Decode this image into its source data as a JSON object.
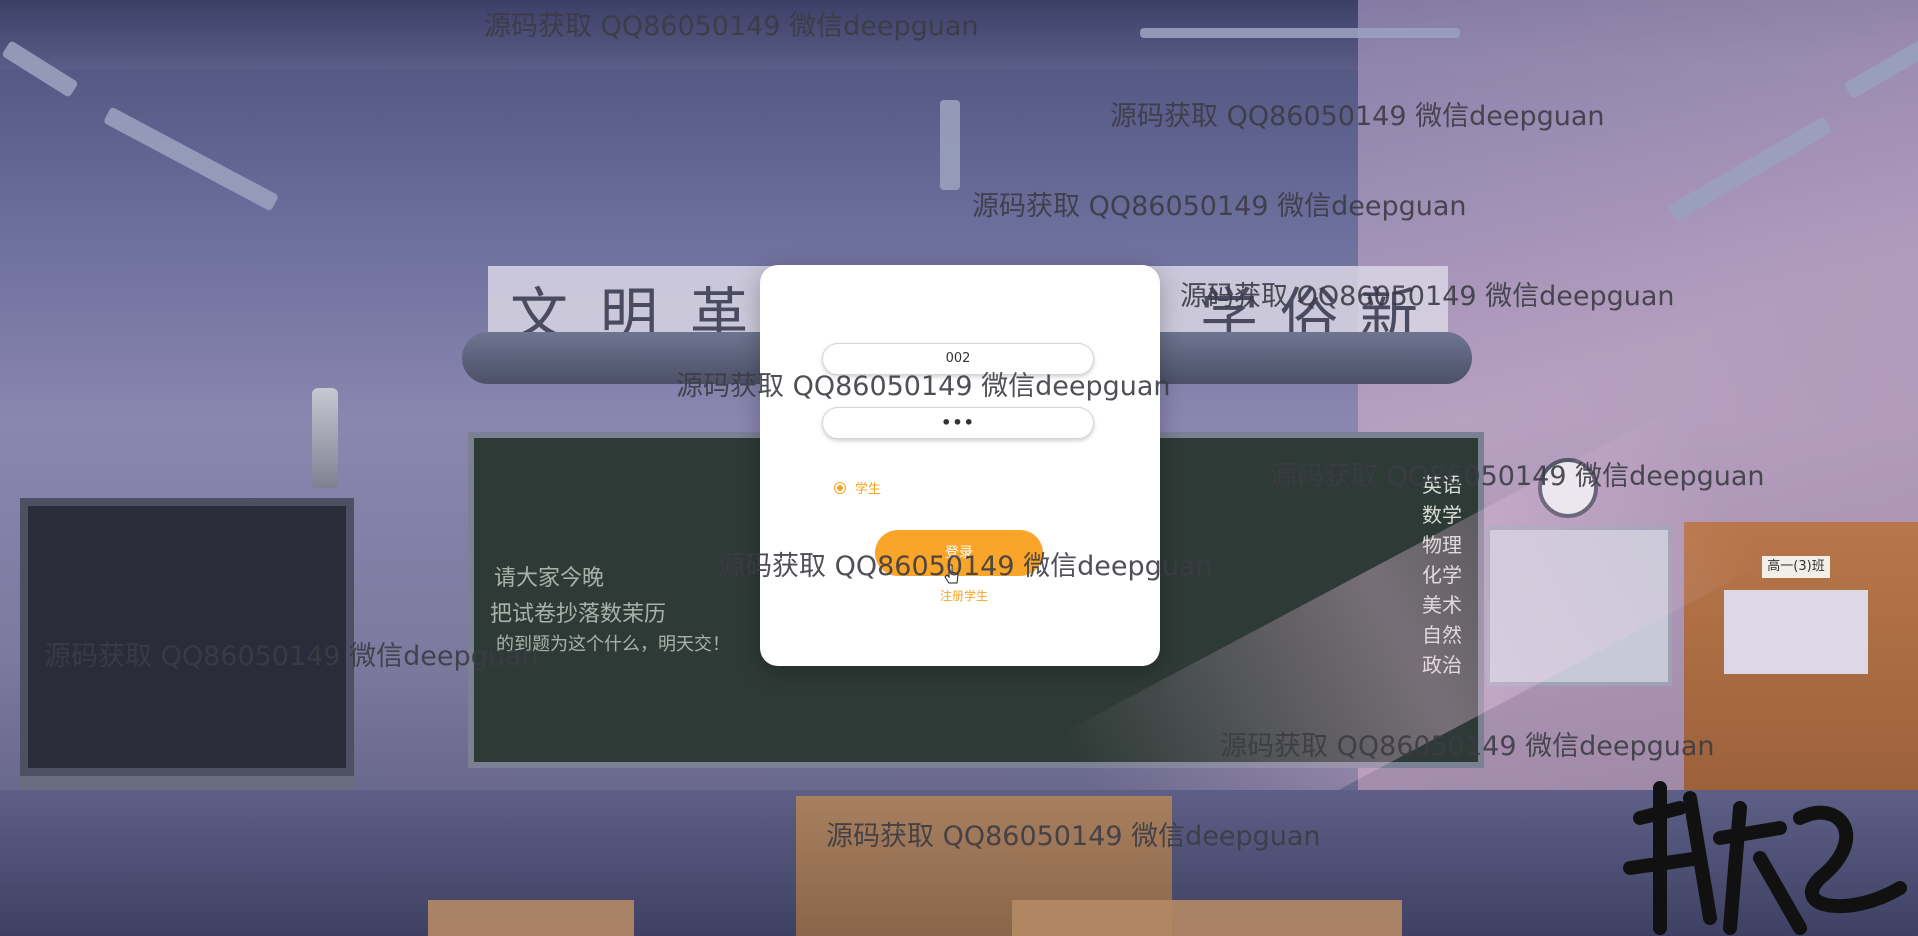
{
  "login": {
    "username_value": "002",
    "password_value": "•••",
    "role_option": "学生",
    "login_label": "登录",
    "register_label": "注册学生"
  },
  "background": {
    "door_sign": "高一(3)班",
    "banner_chars": [
      "文",
      "明",
      "革",
      "学",
      "俗",
      "新"
    ],
    "chalk_lines": [
      "请大家今晚",
      "把试卷抄落数茉历",
      "的到题为这个什么，明天交！"
    ],
    "schedule": [
      "英语",
      "数学",
      "物理",
      "化学",
      "美术",
      "自然",
      "政治"
    ]
  },
  "watermark_text": "源码获取 QQ86050149 微信deepguan",
  "colors": {
    "accent": "#f9a52a",
    "card": "#ffffff"
  }
}
